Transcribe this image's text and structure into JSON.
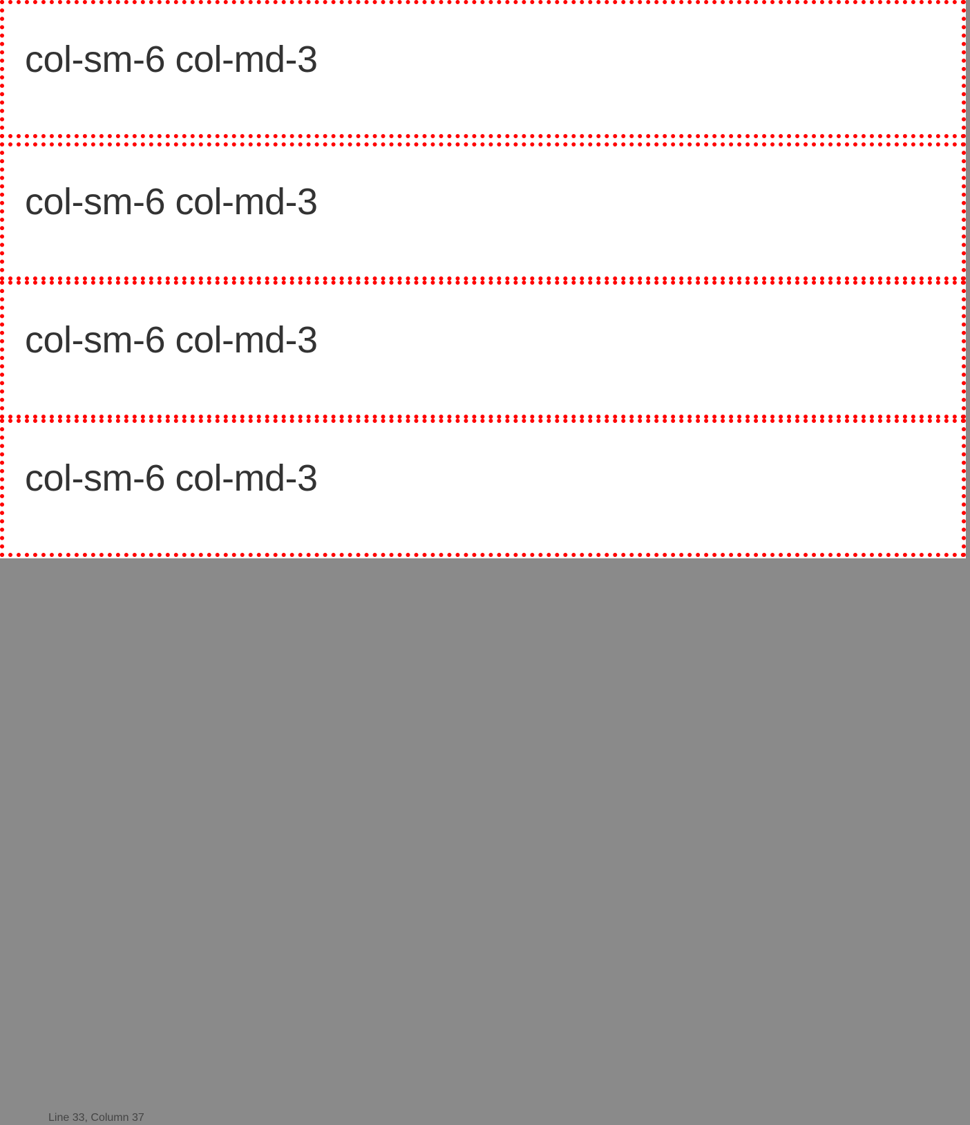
{
  "columns": [
    {
      "label": "col-sm-6 col-md-3"
    },
    {
      "label": "col-sm-6 col-md-3"
    },
    {
      "label": "col-sm-6 col-md-3"
    },
    {
      "label": "col-sm-6 col-md-3"
    }
  ],
  "statusbar": {
    "text": "Line 33, Column 37"
  },
  "colors": {
    "border": "#ff0000",
    "text": "#333333",
    "background": "#ffffff"
  }
}
